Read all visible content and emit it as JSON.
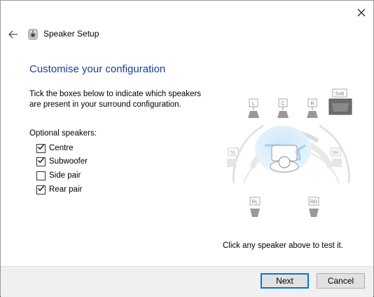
{
  "window": {
    "title": "Speaker Setup"
  },
  "heading": "Customise your configuration",
  "description": "Tick the boxes below to indicate which speakers are present in your surround configuration.",
  "optional_label": "Optional speakers:",
  "options": [
    {
      "label": "Centre",
      "checked": true
    },
    {
      "label": "Subwoofer",
      "checked": true
    },
    {
      "label": "Side pair",
      "checked": false
    },
    {
      "label": "Rear pair",
      "checked": true
    }
  ],
  "speakers": {
    "front_left": "L",
    "center": "C",
    "front_right": "R",
    "subwoofer": "Sub",
    "side_left": "SL",
    "side_right": "SR",
    "rear_left": "RL",
    "rear_right": "RR"
  },
  "hint": "Click any speaker above to test it.",
  "buttons": {
    "next": "Next",
    "cancel": "Cancel"
  },
  "colors": {
    "heading": "#1c3f93",
    "accent": "#0078d7"
  }
}
